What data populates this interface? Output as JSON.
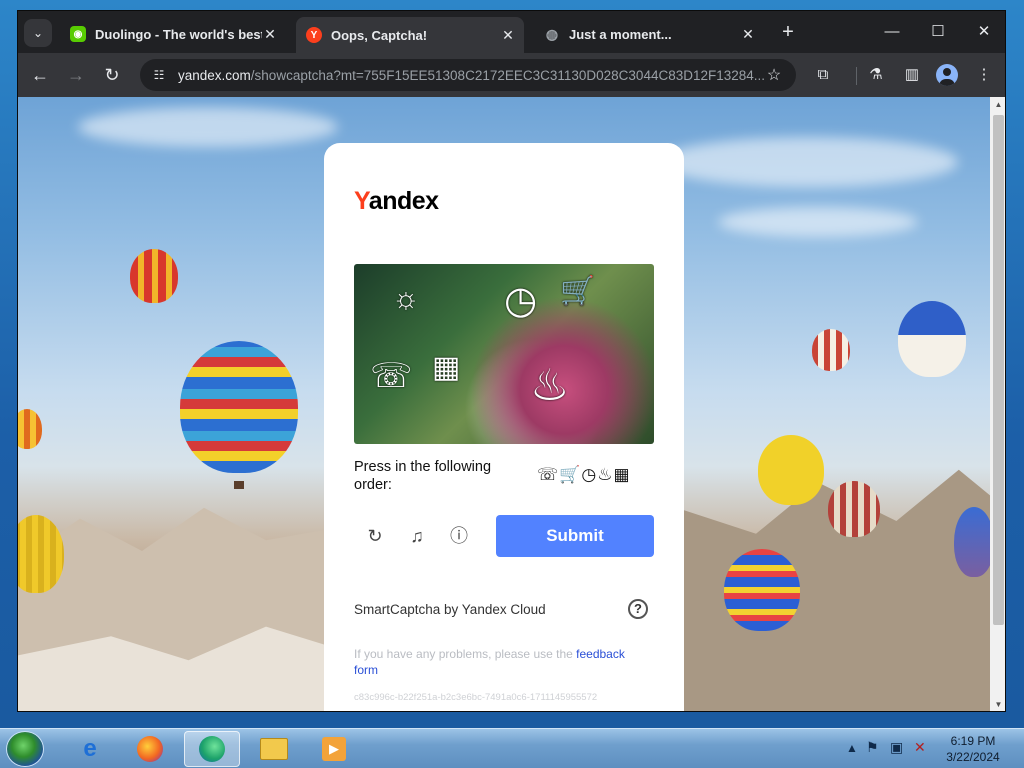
{
  "browser": {
    "tabs": [
      {
        "title": "Duolingo - The world's best wa",
        "favicon": "duolingo-icon",
        "active": false
      },
      {
        "title": "Oops, Captcha!",
        "favicon": "yandex-icon",
        "active": true
      },
      {
        "title": "Just a moment...",
        "favicon": "globe-icon",
        "active": false
      }
    ],
    "url_host": "yandex.com",
    "url_path": "/showcaptcha?mt=755F15EE51308C2172EEC3C31130D028C3044C83D12F13284..."
  },
  "captcha": {
    "logo_y": "Y",
    "logo_rest": "andex",
    "instruction": "Press in the following order:",
    "sequence": "☏🛒◷♨▦",
    "submit_label": "Submit",
    "brand": "SmartCaptcha by Yandex Cloud",
    "help_label": "?",
    "feedback_text": "If you have any problems, please use the ",
    "feedback_link": "feedback form",
    "token": "c83c996c-b22f251a-b2c3e6bc-7491a0c6-1711145955572"
  },
  "taskbar": {
    "time": "6:19 PM",
    "date": "3/22/2024",
    "apps": [
      "internet-explorer",
      "firefox",
      "edge",
      "file-explorer",
      "media-player"
    ]
  }
}
